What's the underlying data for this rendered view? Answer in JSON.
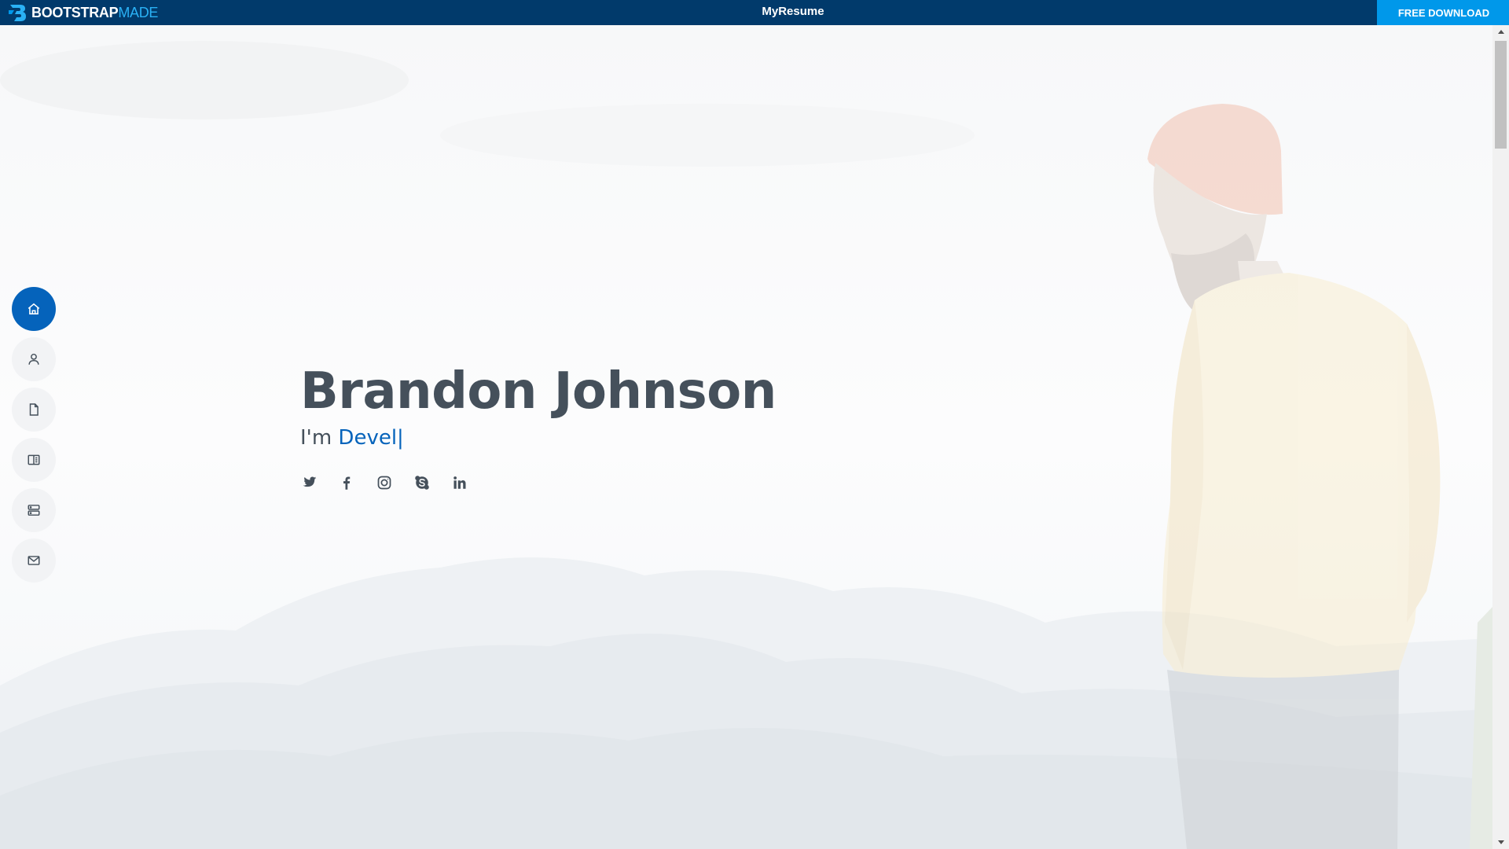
{
  "topbar": {
    "brand_part1": "BOOTSTRAP",
    "brand_part2": "MADE",
    "site_title": "MyResume",
    "download_label": "FREE DOWNLOAD",
    "bg_color": "#013a6b",
    "download_color": "#0098ea",
    "brand_accent": "#2ab1f5"
  },
  "side_nav": {
    "accent": "#0563bb",
    "items": [
      {
        "icon": "home-icon",
        "active": true
      },
      {
        "icon": "person-icon",
        "active": false
      },
      {
        "icon": "file-icon",
        "active": false
      },
      {
        "icon": "book-icon",
        "active": false
      },
      {
        "icon": "server-icon",
        "active": false
      },
      {
        "icon": "envelope-icon",
        "active": false
      }
    ]
  },
  "hero": {
    "name": "Brandon Johnson",
    "prefix": "I'm",
    "typed_text": "Devel",
    "cursor": "|",
    "socials": [
      {
        "icon": "twitter-icon"
      },
      {
        "icon": "facebook-icon"
      },
      {
        "icon": "instagram-icon"
      },
      {
        "icon": "skype-icon"
      },
      {
        "icon": "linkedin-icon"
      }
    ]
  }
}
